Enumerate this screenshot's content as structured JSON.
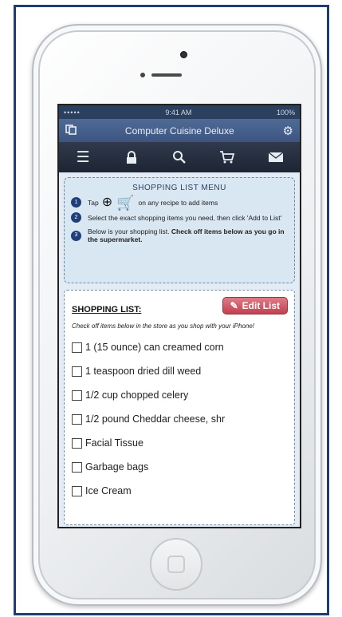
{
  "status_bar": {
    "signal": "•••••",
    "time": "9:41 AM",
    "battery": "100%"
  },
  "title_bar": {
    "title": "Computer Cuisine Deluxe",
    "left_icon": "copy-icon",
    "right_icon": "gear-icon"
  },
  "toolbar": {
    "icons": [
      "list-icon",
      "lock-icon",
      "search-icon",
      "cart-icon",
      "mail-icon"
    ]
  },
  "menu": {
    "title": "SHOPPING LIST MENU",
    "step1_pre": "Tap",
    "step1_post": "on any recipe to add items",
    "step2": "Select the exact shopping items you need, then click 'Add to List'",
    "step3_plain": "Below is your shopping list.",
    "step3_bold": "Check off items below as you go in the supermarket."
  },
  "list": {
    "title": "SHOPPING LIST:",
    "edit_label": "Edit List",
    "instructions": "Check off items below in the store as you shop with your iPhone!",
    "items": [
      "1 (15 ounce) can creamed corn",
      "1 teaspoon dried dill weed",
      "1/2 cup chopped celery",
      "1/2 pound Cheddar cheese, shr",
      "Facial Tissue",
      "Garbage bags",
      "Ice Cream"
    ]
  }
}
